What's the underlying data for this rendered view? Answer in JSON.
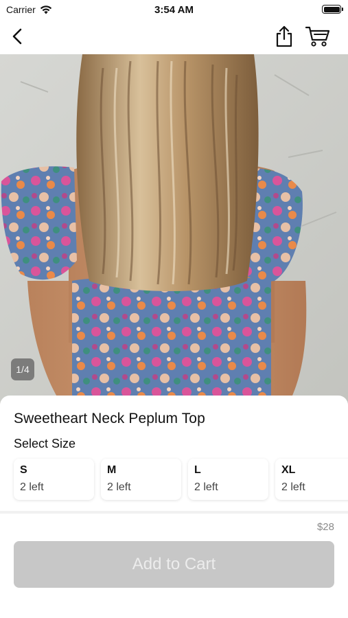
{
  "status_bar": {
    "carrier": "Carrier",
    "time": "3:54 AM"
  },
  "nav": {
    "back_icon": "chevron-left-icon",
    "share_icon": "share-icon",
    "cart_icon": "cart-icon"
  },
  "gallery": {
    "counter": "1/4"
  },
  "product": {
    "title": "Sweetheart Neck Peplum Top",
    "select_size_label": "Select Size",
    "sizes": [
      {
        "name": "S",
        "stock": "2 left"
      },
      {
        "name": "M",
        "stock": "2 left"
      },
      {
        "name": "L",
        "stock": "2 left"
      },
      {
        "name": "XL",
        "stock": "2 left"
      }
    ],
    "price": "$28",
    "add_to_cart_label": "Add to Cart"
  },
  "colors": {
    "button_disabled": "#c7c7c7",
    "price_text": "#8a8a8a"
  }
}
